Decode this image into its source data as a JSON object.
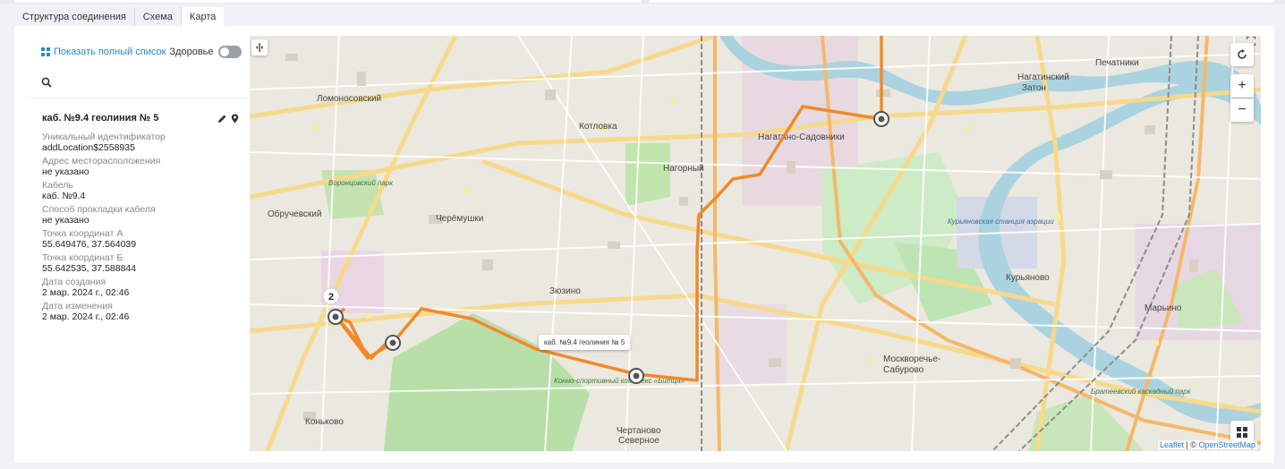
{
  "tabs": [
    {
      "label": "Структура соединения"
    },
    {
      "label": "Схема"
    },
    {
      "label": "Карта"
    }
  ],
  "sidebar": {
    "show_full_list": "Показать полный список",
    "health_label": "Здоровье",
    "health_on": false,
    "cable_title": "каб. №9.4 геолиния № 5",
    "fields": [
      {
        "label": "Уникальный идентификатор",
        "value": "addLocation$2558935"
      },
      {
        "label": "Адрес месторасположения",
        "value": "не указано"
      },
      {
        "label": "Кабель",
        "value": "каб. №9.4"
      },
      {
        "label": "Способ прокладки кабеля",
        "value": "не указано"
      },
      {
        "label": "Точка координат А",
        "value": "55.649476, 37.564039"
      },
      {
        "label": "Точка координат Б",
        "value": "55.642535, 37.588844"
      },
      {
        "label": "Дата создания",
        "value": "2 мар. 2024 г., 02:46"
      },
      {
        "label": "Дата изменения",
        "value": "2 мар. 2024 г., 02:46"
      }
    ]
  },
  "map": {
    "popup": "каб. №9.4 геолиния № 5",
    "cluster_count": "2",
    "attribution_leaflet": "Leaflet",
    "attribution_sep": " | © ",
    "attribution_osm": "OpenStreetMap",
    "route_color": "#f0892a",
    "labels": {
      "lomonosovsky": "Ломоносовский",
      "kotlovka": "Котловка",
      "nagorny": "Нагорный",
      "nagatino": "Нагатино-Садовники",
      "obruchevsky": "Обручевский",
      "cheryomushki": "Черёмушки",
      "zyuzino": "Зюзино",
      "konkovo": "Коньково",
      "chertanovo1": "Чертаново",
      "chertanovo2": "Северное",
      "kuryanovo": "Курьяново",
      "maryino": "Марьино",
      "moskvorechye1": "Москворечье-",
      "moskvorechye2": "Сабурово",
      "pechatniki": "Печатники",
      "nagatinsky1": "Нагатинский",
      "nagatinsky2": "Затон",
      "vorontsovsky": "Воронцовский парк",
      "kuryanovskaya": "Курьяновская станция аэрации",
      "bitsa": "Конно-спортивный комплекс «Битца»",
      "bratesky": "Братеевский каскадный парк"
    }
  }
}
